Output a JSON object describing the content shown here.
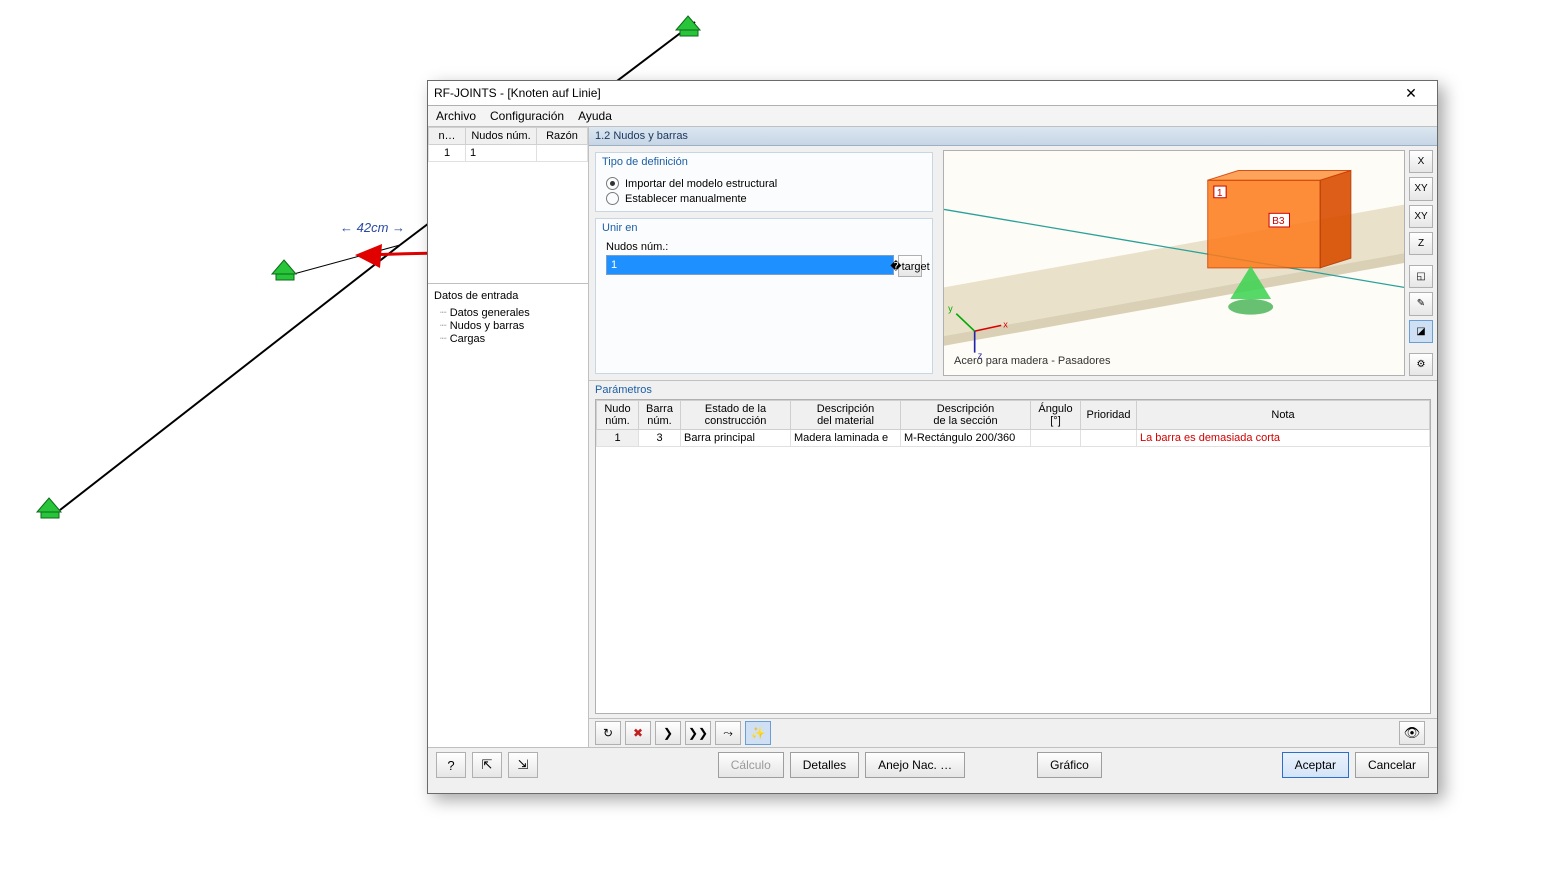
{
  "window": {
    "title": "RF-JOINTS - [Knoten auf Linie]"
  },
  "menu": {
    "file": "Archivo",
    "config": "Configuración",
    "help": "Ayuda"
  },
  "topgrid": {
    "col_n": "n…",
    "col_nodes": "Nudos núm.",
    "col_reason": "Razón",
    "rows": [
      {
        "n": "1",
        "nodes": "1",
        "reason": ""
      }
    ]
  },
  "tree": {
    "title": "Datos de entrada",
    "items": [
      "Datos generales",
      "Nudos y barras",
      "Cargas"
    ]
  },
  "content_header": "1.2 Nudos y barras",
  "definition_type": {
    "title": "Tipo de definición",
    "import": "Importar del modelo estructural",
    "manual": "Establecer manualmente",
    "selected": "import"
  },
  "join_in": {
    "title": "Unir en",
    "label": "Nudos núm.:",
    "value": "1"
  },
  "preview": {
    "note": "Acero para madera - Pasadores",
    "node_label": "1",
    "member_label": "B3"
  },
  "view_tools": [
    "X",
    "XY",
    "XY",
    "Z",
    "◱",
    "✎",
    "◪",
    "⚙"
  ],
  "parameters": {
    "title": "Parámetros",
    "headers": {
      "node": "Nudo\nnúm.",
      "member": "Barra\nnúm.",
      "status": "Estado de la\nconstrucción",
      "material": "Descripción\ndel material",
      "section": "Descripción\nde la sección",
      "angle": "Ángulo\n[°]",
      "priority": "Prioridad",
      "note": "Nota"
    },
    "rows": [
      {
        "node": "1",
        "member": "3",
        "status": "Barra principal",
        "material": "Madera laminada e",
        "section": "M-Rectángulo 200/360",
        "angle": "",
        "priority": "",
        "note": "La barra es demasiada corta"
      }
    ]
  },
  "mini_toolbar": [
    "↻",
    "✖",
    "❯",
    "❯❯",
    "⤳",
    "✨"
  ],
  "footer": {
    "help": "?",
    "prev": "⤒",
    "next": "⤓",
    "calc": "Cálculo",
    "details": "Detalles",
    "annex": "Anejo Nac. …",
    "graphic": "Gráfico",
    "ok": "Aceptar",
    "cancel": "Cancelar"
  },
  "bg": {
    "dim_label": "← 42cm →"
  }
}
